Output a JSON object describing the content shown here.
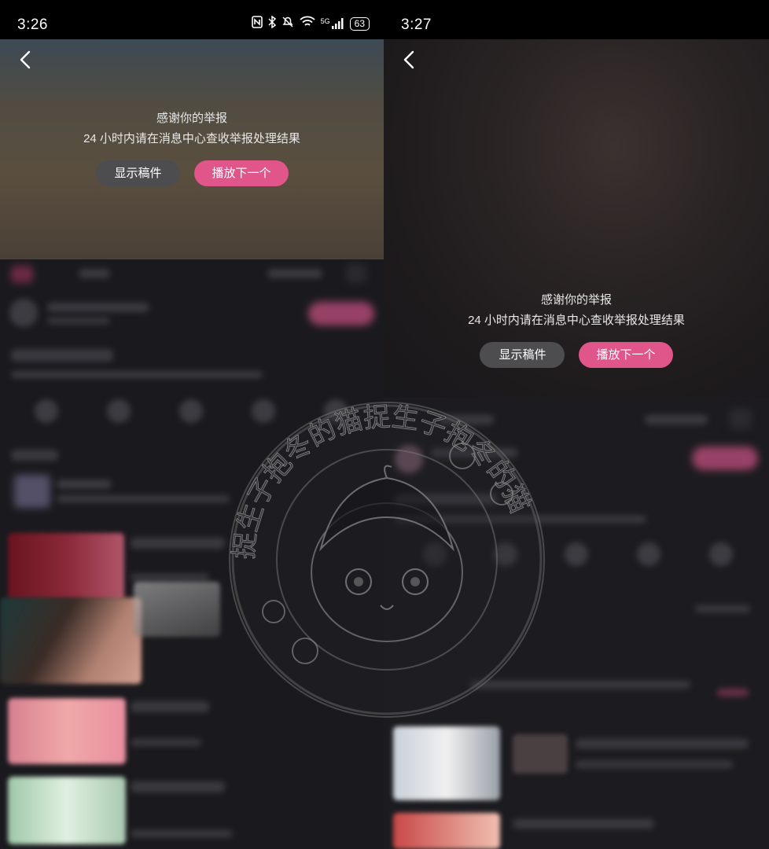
{
  "left_panel": {
    "status_bar": {
      "time": "3:26",
      "battery": "63",
      "network": "5G",
      "icons": [
        "nfc-icon",
        "bluetooth-icon",
        "mute-icon",
        "wifi-icon",
        "signal-icon",
        "battery-icon"
      ]
    },
    "report_overlay": {
      "message_line1": "感谢你的举报",
      "message_line2": "24 小时内请在消息中心查收举报处理结果",
      "show_button_label": "显示稿件",
      "next_button_label": "播放下一个"
    }
  },
  "right_panel": {
    "status_bar": {
      "time": "3:27"
    },
    "report_overlay": {
      "message_line1": "感谢你的举报",
      "message_line2": "24 小时内请在消息中心查收举报处理结果",
      "show_button_label": "显示稿件",
      "next_button_label": "播放下一个"
    }
  },
  "watermark": {
    "text": "捉生子抱冬的猫捉生子抱冬的猫"
  },
  "colors": {
    "accent_pink": "#e0558a",
    "button_grey": "#4d4d50",
    "background": "#1a1a1e"
  }
}
